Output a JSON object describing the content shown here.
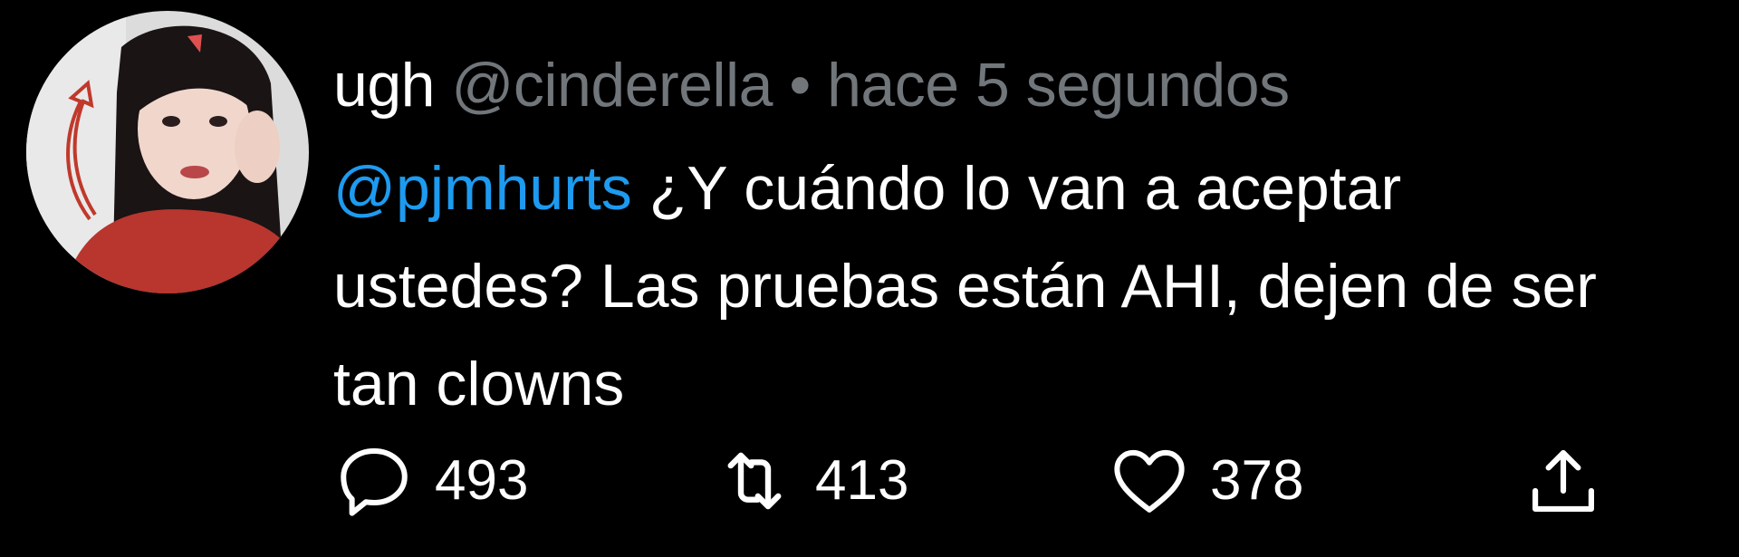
{
  "tweet": {
    "display_name": "ugh",
    "handle": "@cinderella",
    "separator": "•",
    "timestamp": "hace 5 segundos",
    "mention": "@pjmhurts",
    "text": "¿Y cuándo lo van a aceptar ustedes? Las pruebas están AHI, dejen de ser tan clowns",
    "avatar_icon": "avatar-photo"
  },
  "actions": {
    "reply": {
      "icon": "reply-icon",
      "count": "493"
    },
    "retweet": {
      "icon": "retweet-icon",
      "count": "413"
    },
    "like": {
      "icon": "heart-icon",
      "count": "378"
    },
    "share": {
      "icon": "share-icon"
    }
  },
  "colors": {
    "background": "#000000",
    "primary_text": "#ffffff",
    "secondary_text": "#71767b",
    "mention": "#1d9bf0"
  }
}
